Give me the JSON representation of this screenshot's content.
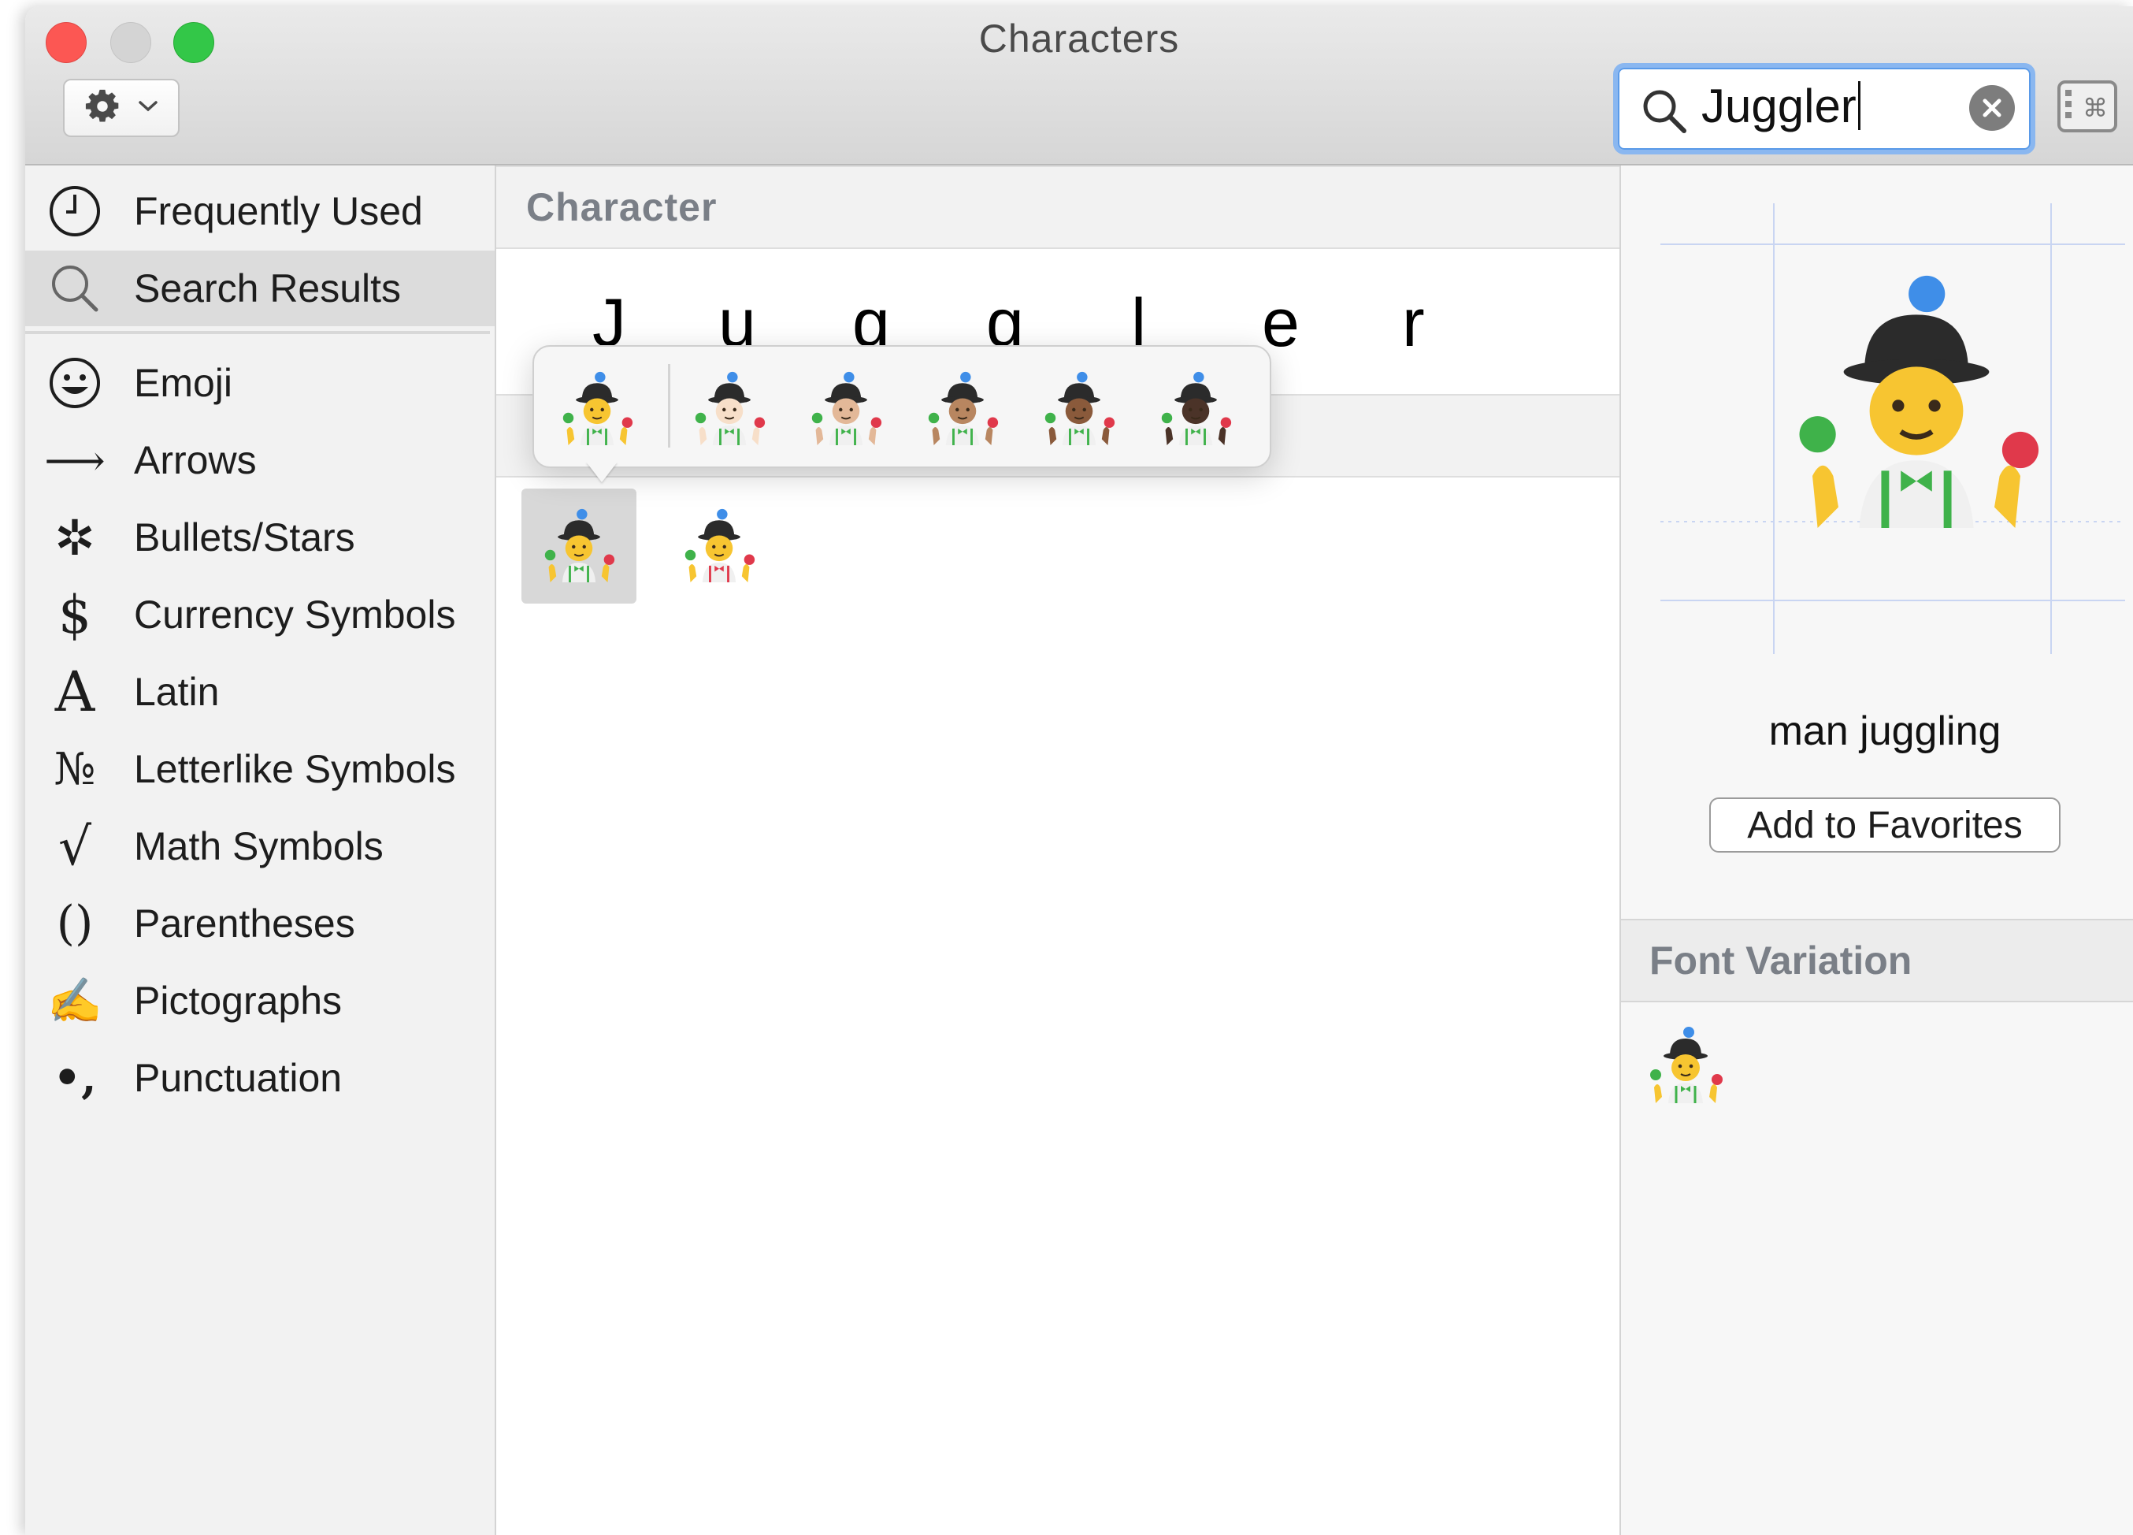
{
  "window": {
    "title": "Characters"
  },
  "toolbar": {
    "action_menu_icon": "gear-icon",
    "search": {
      "value": "Juggler"
    }
  },
  "sidebar": {
    "items": [
      {
        "label": "Frequently Used",
        "icon": "clock-icon"
      },
      {
        "label": "Search Results",
        "icon": "search-icon",
        "selected": true
      },
      {
        "label": "Emoji",
        "icon": "smiley-icon"
      },
      {
        "label": "Arrows",
        "icon": "arrow-icon",
        "glyph": "⟶"
      },
      {
        "label": "Bullets/Stars",
        "icon": "asterisk-icon",
        "glyph": "✲"
      },
      {
        "label": "Currency Symbols",
        "icon": "dollar-icon",
        "glyph": "$"
      },
      {
        "label": "Latin",
        "icon": "letter-a-icon",
        "glyph": "A"
      },
      {
        "label": "Letterlike Symbols",
        "icon": "numero-icon",
        "glyph": "№"
      },
      {
        "label": "Math Symbols",
        "icon": "square-root-icon",
        "glyph": "√"
      },
      {
        "label": "Parentheses",
        "icon": "parentheses-icon",
        "glyph": "()"
      },
      {
        "label": "Pictographs",
        "icon": "writing-hand-icon",
        "glyph": "✍"
      },
      {
        "label": "Punctuation",
        "icon": "punctuation-icon",
        "glyph": "•,"
      }
    ]
  },
  "middle": {
    "section_title": "Character",
    "letters": [
      "J",
      "u",
      "g",
      "g",
      "l",
      "e",
      "r"
    ],
    "results": [
      {
        "name": "man-juggling-icon",
        "tie": "#3fb24a",
        "selected": true
      },
      {
        "name": "woman-juggling-icon",
        "tie": "#e0394b",
        "selected": false
      }
    ],
    "skin_tone_popover": [
      {
        "name": "skin-tone-default-icon",
        "skin": "#f7c531"
      },
      {
        "name": "skin-tone-light-icon",
        "skin": "#f7dfc9"
      },
      {
        "name": "skin-tone-medium-light-icon",
        "skin": "#e3b898"
      },
      {
        "name": "skin-tone-medium-icon",
        "skin": "#b88660"
      },
      {
        "name": "skin-tone-medium-dark-icon",
        "skin": "#8a5a3b"
      },
      {
        "name": "skin-tone-dark-icon",
        "skin": "#4b3328"
      }
    ]
  },
  "inspector": {
    "character_name": "man juggling",
    "add_to_favorites_label": "Add to Favorites",
    "font_variation_title": "Font Variation"
  },
  "colors": {
    "search_focus_ring": "#8ab7f0",
    "section_header_text": "#7a7f87",
    "close": "#fc5753",
    "maximize": "#33c748"
  }
}
